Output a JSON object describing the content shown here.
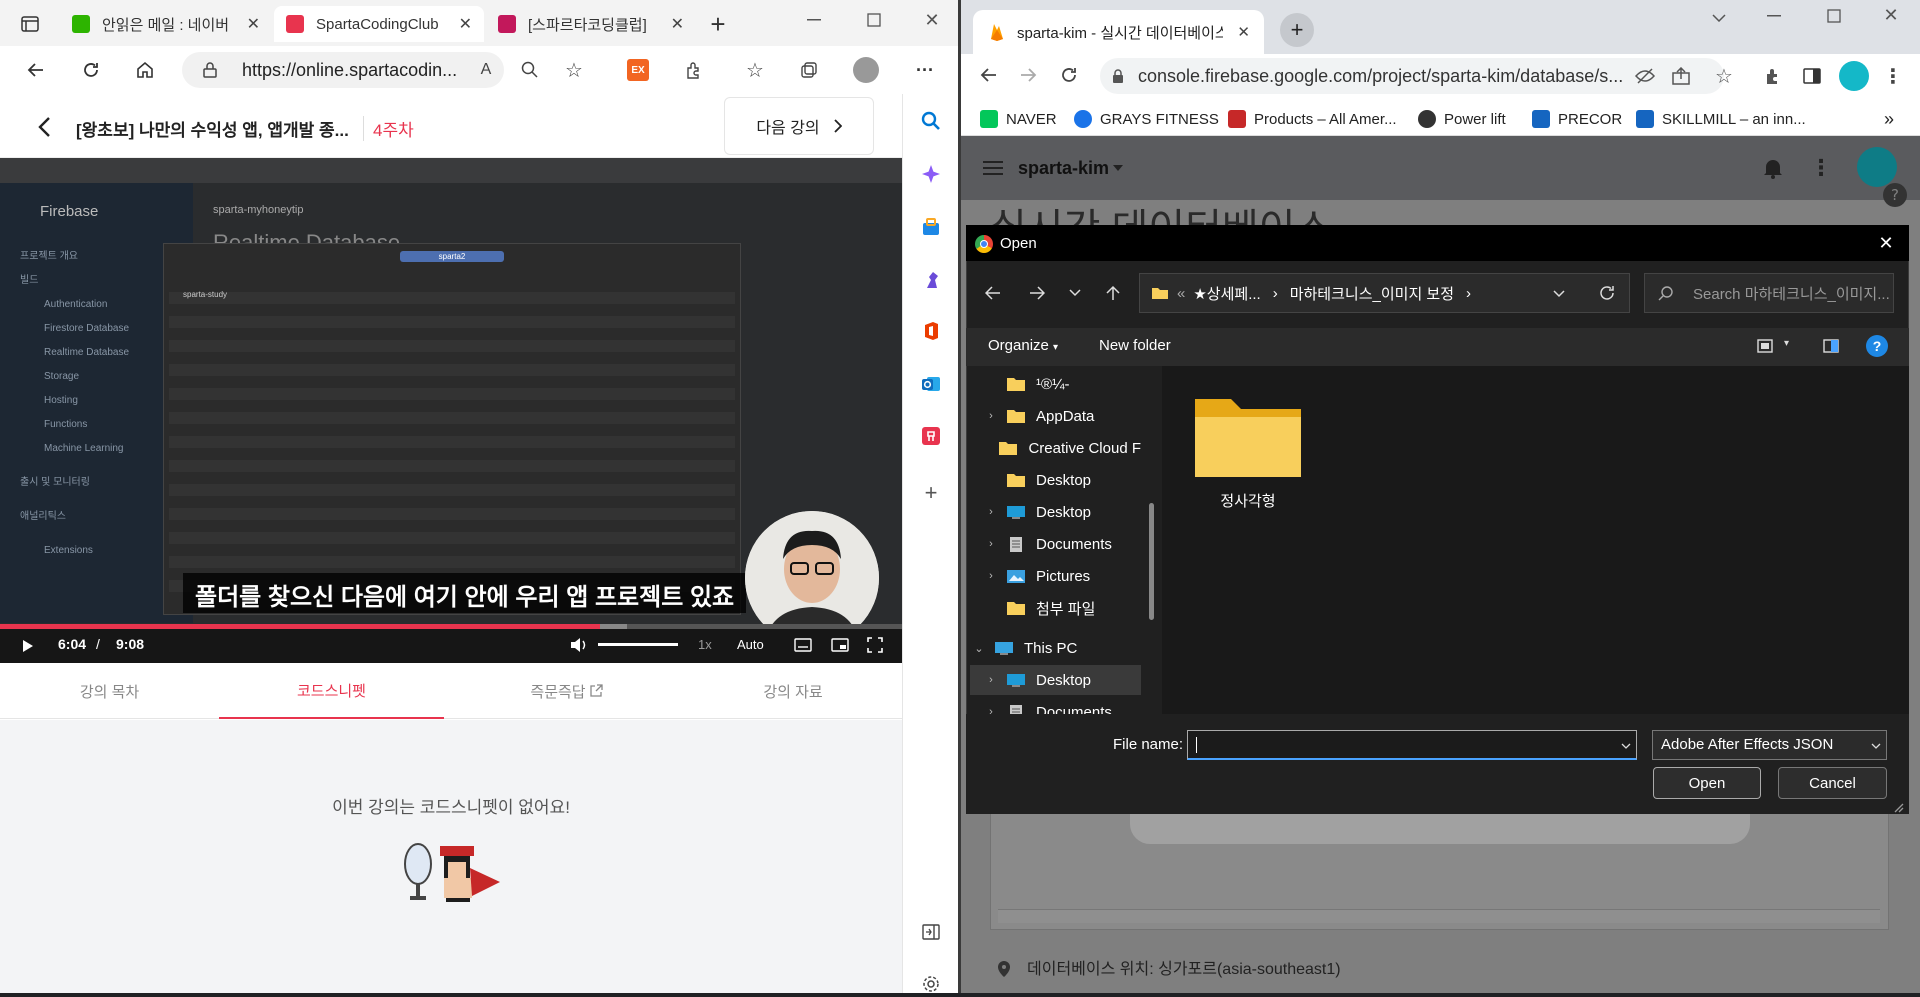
{
  "left_browser": {
    "tabs": [
      {
        "title": "안읽은 메일 : 네이버",
        "favicon_color": "#2db400"
      },
      {
        "title": "SpartaCodingClub",
        "favicon_color": "#e8344e",
        "active": true
      },
      {
        "title": "[스파르타코딩클럽]",
        "favicon_color": "#e8344e"
      }
    ],
    "new_tab": "+",
    "url": "https://online.spartacodin...",
    "extension_badge": "EX",
    "more": "···"
  },
  "course": {
    "title": "[왕초보] 나만의 수익성 앱, 앱개발 종...",
    "week": "4주차",
    "next_label": "다음 강의"
  },
  "video": {
    "inner_labels": {
      "firebase": "Firebase",
      "project": "sparta-myhoneytip",
      "realtime": "Realtime Database",
      "folder_dropdown": "sparta2",
      "row_file": "sparta-study"
    },
    "inner_sidebar": [
      "프로젝트 개요",
      "빌드",
      "Authentication",
      "Firestore Database",
      "Realtime Database",
      "Storage",
      "Hosting",
      "Functions",
      "Machine Learning",
      "출시 및 모니터링",
      "애널리틱스",
      "Extensions"
    ],
    "subtitle": "폴더를 찾으신 다음에 여기 안에 우리 앱 프로젝트 있죠",
    "time_current": "6:04",
    "time_sep": "/",
    "time_total": "9:08",
    "progress": 0.665,
    "buffered": 0.695,
    "speed": "1x",
    "quality": "Auto"
  },
  "course_tabs": [
    "강의 목차",
    "코드스니펫",
    "즉문즉답",
    "강의 자료"
  ],
  "snippet_empty": "이번 강의는 코드스니펫이 없어요!",
  "right_browser": {
    "tab_title": "sparta-kim - 실시간 데이터베이스",
    "url": "console.firebase.google.com/project/sparta-kim/database/s...",
    "bookmarks": [
      {
        "label": "NAVER",
        "color": "#03c75a"
      },
      {
        "label": "GRAYS FITNESS",
        "color": "#1a73e8"
      },
      {
        "label": "Products – All Amer...",
        "color": "#c62828"
      },
      {
        "label": "Power lift",
        "color": "#333333"
      },
      {
        "label": "PRECOR",
        "color": "#1565c0"
      },
      {
        "label": "SKILLMILL – an inn...",
        "color": "#1565c0"
      }
    ],
    "more_bookmarks": "»"
  },
  "firebase": {
    "project": "sparta-kim",
    "page_title": "실시간 데이터베이스",
    "location": "데이터베이스 위치: 싱가포르(asia-southeast1)"
  },
  "dialog": {
    "title": "Open",
    "breadcrumb": [
      "★상세페...",
      "마하테크니스_이미지 보정"
    ],
    "breadcrumb_prefix": "«",
    "search_placeholder": "Search 마하테크니스_이미지...",
    "organize": "Organize",
    "new_folder": "New folder",
    "nav_items": [
      {
        "label": "¹®¼-",
        "icon": "folder",
        "arrow": ""
      },
      {
        "label": "AppData",
        "icon": "folder",
        "arrow": "›"
      },
      {
        "label": "Creative Cloud F",
        "icon": "folder",
        "arrow": ""
      },
      {
        "label": "Desktop",
        "icon": "folder",
        "arrow": ""
      },
      {
        "label": "Desktop",
        "icon": "desktop",
        "arrow": "›"
      },
      {
        "label": "Documents",
        "icon": "docs",
        "arrow": "›"
      },
      {
        "label": "Pictures",
        "icon": "pics",
        "arrow": "›"
      },
      {
        "label": "첨부 파일",
        "icon": "folder",
        "arrow": ""
      },
      {
        "label": "This PC",
        "icon": "pc",
        "arrow": "⌄"
      },
      {
        "label": "Desktop",
        "icon": "desktop",
        "arrow": "›",
        "selected": true
      },
      {
        "label": "Documents",
        "icon": "docs",
        "arrow": "›"
      }
    ],
    "file_items": [
      {
        "label": "정사각형"
      }
    ],
    "file_name_label": "File name:",
    "file_name_value": "",
    "file_type": "Adobe After Effects JSON",
    "open_label": "Open",
    "cancel_label": "Cancel"
  },
  "colors": {
    "sparta_red": "#e8344e",
    "dialog_bg": "#202020",
    "folder_yellow": "#f8cf5c"
  }
}
